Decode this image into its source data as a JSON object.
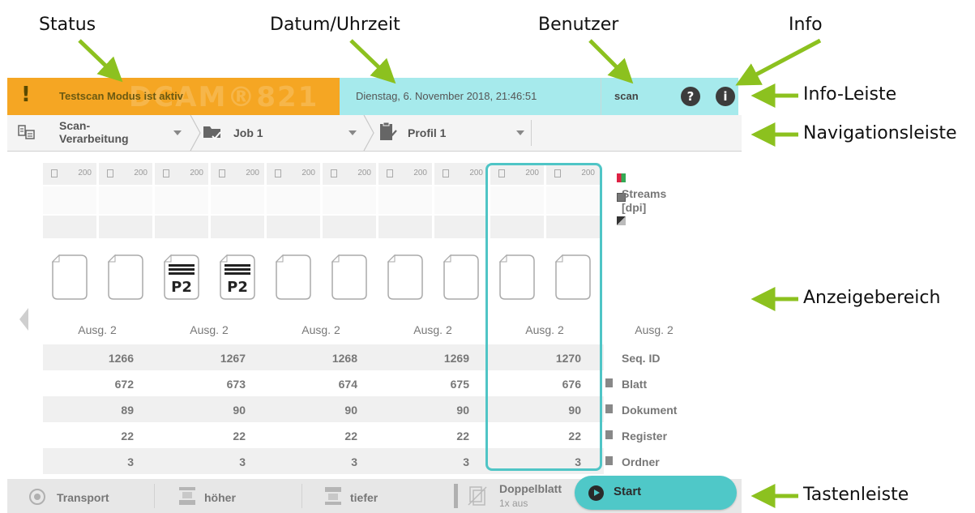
{
  "callouts": {
    "status": "Status",
    "datetime": "Datum/Uhrzeit",
    "user": "Benutzer",
    "info": "Info",
    "infobar": "Info-Leiste",
    "navbar": "Navigationsleiste",
    "display": "Anzeigebereich",
    "buttonbar": "Tastenleiste"
  },
  "colors": {
    "accent": "#8cc11f",
    "status_bg": "#f5a623",
    "info_bg": "#a6eaec",
    "highlight": "#4fc5c6",
    "start_bg": "#4fc8c8"
  },
  "infobar": {
    "status_mark": "!",
    "status_text": "Testscan Modus ist aktiv",
    "watermark": "DCAM®821",
    "datetime": "Dienstag, 6. November 2018, 21:46:51",
    "user": "scan",
    "help_icon": "?",
    "info_icon": "i"
  },
  "navbar": {
    "items": [
      {
        "label_line1": "Scan-",
        "label_line2": "Verarbeitung",
        "icon": "scan-processing-icon"
      },
      {
        "label": "Job 1",
        "icon": "folder-job-icon"
      },
      {
        "label": "Profil 1",
        "icon": "clipboard-profile-icon"
      }
    ]
  },
  "display": {
    "dpi_header": [
      "200",
      "200",
      "200",
      "200",
      "200",
      "200",
      "200",
      "200",
      "200",
      "200"
    ],
    "pages": [
      "blank",
      "blank",
      "p2",
      "p2",
      "blank",
      "blank",
      "blank",
      "blank",
      "blank",
      "blank"
    ],
    "page_mark": "P2",
    "output_label": "Ausg. 2",
    "outputs": [
      "Ausg. 2",
      "Ausg. 2",
      "Ausg. 2",
      "Ausg. 2",
      "Ausg. 2"
    ],
    "output_right": "Ausg. 2",
    "streams_label_line1": "Streams",
    "streams_label_line2": "[dpi]",
    "rows": [
      {
        "label": "Seq. ID",
        "icon": "",
        "values": [
          "1266",
          "1267",
          "1268",
          "1269",
          "1270"
        ]
      },
      {
        "label": "Blatt",
        "icon": "sheet-icon",
        "values": [
          "672",
          "673",
          "674",
          "675",
          "676"
        ]
      },
      {
        "label": "Dokument",
        "icon": "document-icon",
        "values": [
          "89",
          "90",
          "90",
          "90",
          "90"
        ]
      },
      {
        "label": "Register",
        "icon": "register-icon",
        "values": [
          "22",
          "22",
          "22",
          "22",
          "22"
        ]
      },
      {
        "label": "Ordner",
        "icon": "folder-icon",
        "values": [
          "3",
          "3",
          "3",
          "3",
          "3"
        ]
      }
    ]
  },
  "buttonbar": {
    "transport": "Transport",
    "higher": "höher",
    "lower": "tiefer",
    "double_sheet_line1": "Doppelblatt",
    "double_sheet_line2": "1x aus",
    "start": "Start"
  }
}
